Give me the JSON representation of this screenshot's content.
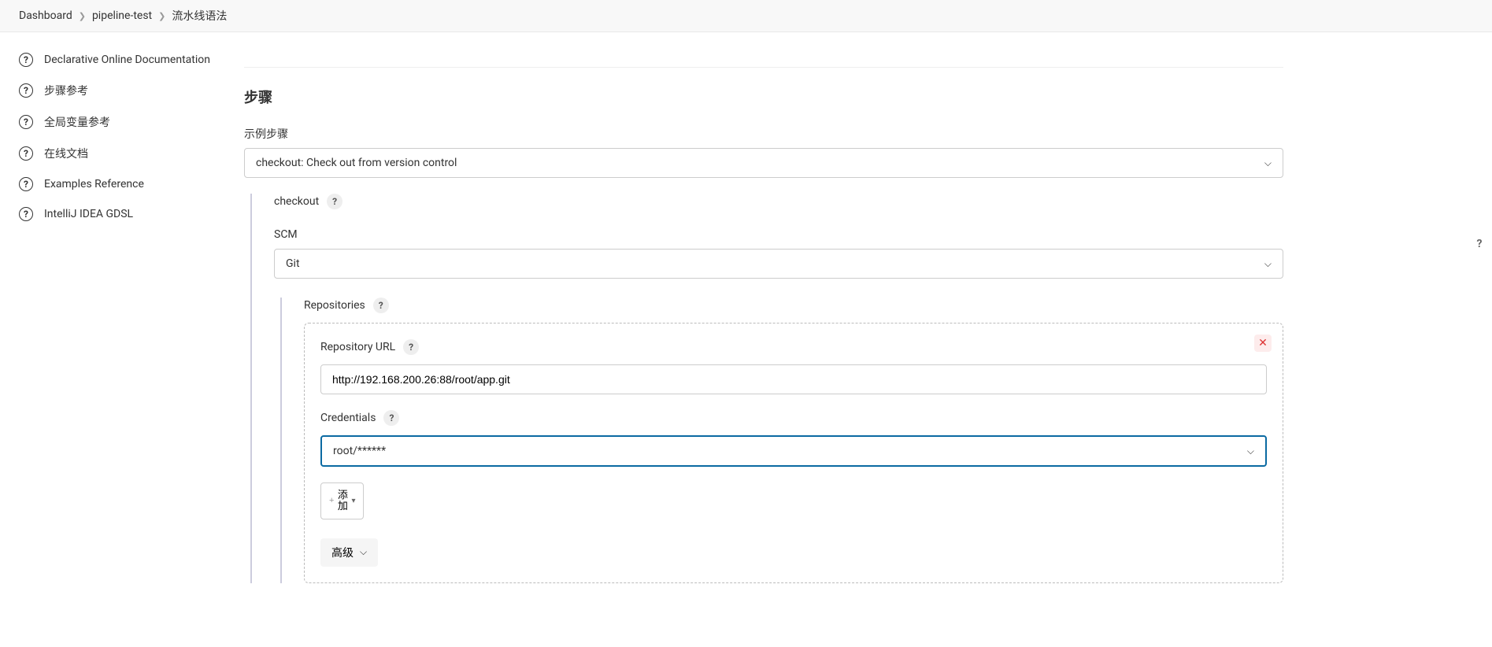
{
  "breadcrumb": {
    "items": [
      "Dashboard",
      "pipeline-test",
      "流水线语法"
    ]
  },
  "sidebar": {
    "items": [
      "Declarative Online Documentation",
      "步骤参考",
      "全局变量参考",
      "在线文档",
      "Examples Reference",
      "IntelliJ IDEA GDSL"
    ]
  },
  "main": {
    "section_title": "步骤",
    "sample_step_label": "示例步骤",
    "sample_step_value": "checkout: Check out from version control",
    "checkout_label": "checkout",
    "scm_label": "SCM",
    "scm_value": "Git",
    "repositories_label": "Repositories",
    "repo_url_label": "Repository URL",
    "repo_url_value": "http://192.168.200.26:88/root/app.git",
    "credentials_label": "Credentials",
    "credentials_value": "root/******",
    "add_button": "添加",
    "advanced_button": "高级"
  }
}
